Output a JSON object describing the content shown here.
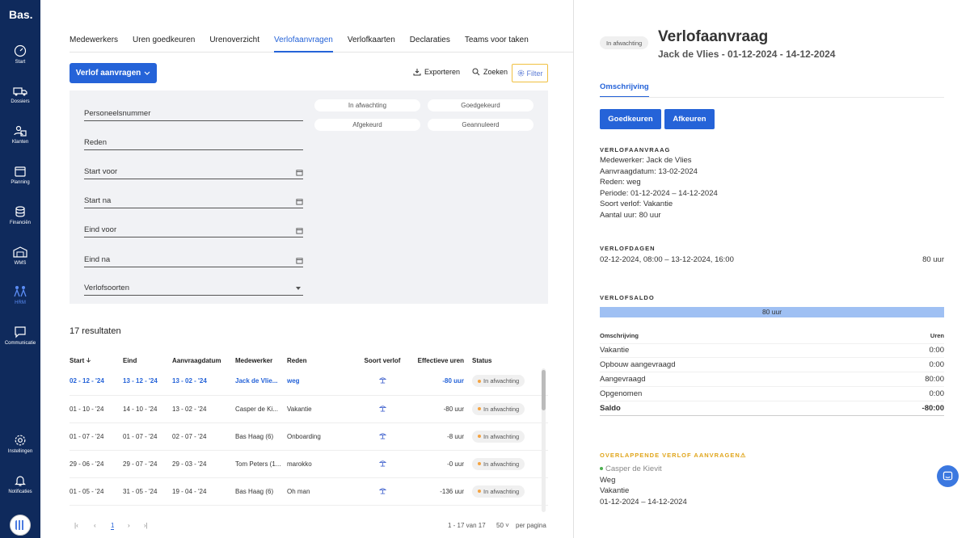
{
  "app": {
    "logo": "Bas."
  },
  "sidebar": {
    "items": [
      {
        "label": "Start",
        "icon": "gauge-icon"
      },
      {
        "label": "Dossiers",
        "icon": "truck-icon"
      },
      {
        "label": "Klanten",
        "icon": "users-icon"
      },
      {
        "label": "Planning",
        "icon": "calendar-icon"
      },
      {
        "label": "Financiën",
        "icon": "coins-icon"
      },
      {
        "label": "WMS",
        "icon": "warehouse-icon"
      },
      {
        "label": "HRM",
        "icon": "people-icon"
      },
      {
        "label": "Communicatie",
        "icon": "chat-icon"
      },
      {
        "label": "Instellingen",
        "icon": "gear-icon"
      },
      {
        "label": "Notificaties",
        "icon": "bell-icon"
      }
    ]
  },
  "tabs": [
    "Medewerkers",
    "Uren goedkeuren",
    "Urenoverzicht",
    "Verlofaanvragen",
    "Verlofkaarten",
    "Declaraties",
    "Teams voor taken"
  ],
  "toolbar": {
    "request": "Verlof aanvragen",
    "export": "Exporteren",
    "search": "Zoeken",
    "filter": "Filter"
  },
  "filters": {
    "fields": [
      "Personeelsnummer",
      "Reden",
      "Start voor",
      "Start na",
      "Eind voor",
      "Eind na",
      "Verlofsoorten"
    ],
    "chips": [
      "In afwachting",
      "Goedgekeurd",
      "Afgekeurd",
      "Geannuleerd"
    ]
  },
  "results": "17 resultaten",
  "table": {
    "headers": [
      "Start",
      "Eind",
      "Aanvraagdatum",
      "Medewerker",
      "Reden",
      "Soort verlof",
      "Effectieve uren",
      "Status"
    ],
    "rows": [
      {
        "start": "02 - 12 - '24",
        "end": "13 - 12 - '24",
        "requested": "13 - 02 - '24",
        "employee": "Jack de Vlie...",
        "reason": "weg",
        "hours": "-80 uur",
        "status": "In afwachting"
      },
      {
        "start": "01 - 10 - '24",
        "end": "14 - 10 - '24",
        "requested": "13 - 02 - '24",
        "employee": "Casper de Ki...",
        "reason": "Vakantie",
        "hours": "-80 uur",
        "status": "In afwachting"
      },
      {
        "start": "01 - 07 - '24",
        "end": "01 - 07 - '24",
        "requested": "02 - 07 - '24",
        "employee": "Bas Haag (6)",
        "reason": "Onboarding",
        "hours": "-8 uur",
        "status": "In afwachting"
      },
      {
        "start": "29 - 06 - '24",
        "end": "29 - 07 - '24",
        "requested": "29 - 03 - '24",
        "employee": "Tom Peters (1...",
        "reason": "marokko",
        "hours": "-0 uur",
        "status": "In afwachting"
      },
      {
        "start": "01 - 05 - '24",
        "end": "31 - 05 - '24",
        "requested": "19 - 04 - '24",
        "employee": "Bas Haag (6)",
        "reason": "Oh man",
        "hours": "-136 uur",
        "status": "In afwachting"
      }
    ]
  },
  "pagination": {
    "page": "1",
    "range": "1 - 17 van 17",
    "per_page": "50",
    "per_page_label": "per pagina"
  },
  "detail": {
    "status": "In afwachting",
    "title": "Verlofaanvraag",
    "subtitle": "Jack de Vlies - 01-12-2024 - 14-12-2024",
    "tab": "Omschrijving",
    "approve": "Goedkeuren",
    "reject": "Afkeuren",
    "sec_request": "VERLOFAANVRAAG",
    "request_lines": [
      "Medewerker: Jack de Vlies",
      "Aanvraagdatum: 13-02-2024",
      "Reden: weg",
      "Periode: 01-12-2024 – 14-12-2024",
      "Soort verlof: Vakantie",
      "Aantal uur: 80 uur"
    ],
    "sec_days": "VERLOFDAGEN",
    "days_range": "02-12-2024, 08:00 – 13-12-2024, 16:00",
    "days_hours": "80 uur",
    "sec_saldo": "VERLOFSALDO",
    "saldo_bar": "80 uur",
    "saldo_head": {
      "left": "Omschrijving",
      "right": "Uren"
    },
    "saldo_rows": [
      {
        "label": "Vakantie",
        "value": "0:00"
      },
      {
        "label": "Opbouw aangevraagd",
        "value": "0:00"
      },
      {
        "label": "Aangevraagd",
        "value": "80:00"
      },
      {
        "label": "Opgenomen",
        "value": "0:00"
      }
    ],
    "saldo_total": {
      "label": "Saldo",
      "value": "-80:00"
    },
    "sec_overlap": "OVERLAPPENDE VERLOF AANVRAGEN",
    "overlap": {
      "name": "Casper de Kievit",
      "reason": "Weg",
      "type": "Vakantie",
      "period": "01-12-2024 – 14-12-2024"
    }
  },
  "colors": {
    "sidebar": "#0f2a5c",
    "accent": "#2563d8",
    "warning": "#e0a51b",
    "saldo": "#9fc0f3"
  }
}
